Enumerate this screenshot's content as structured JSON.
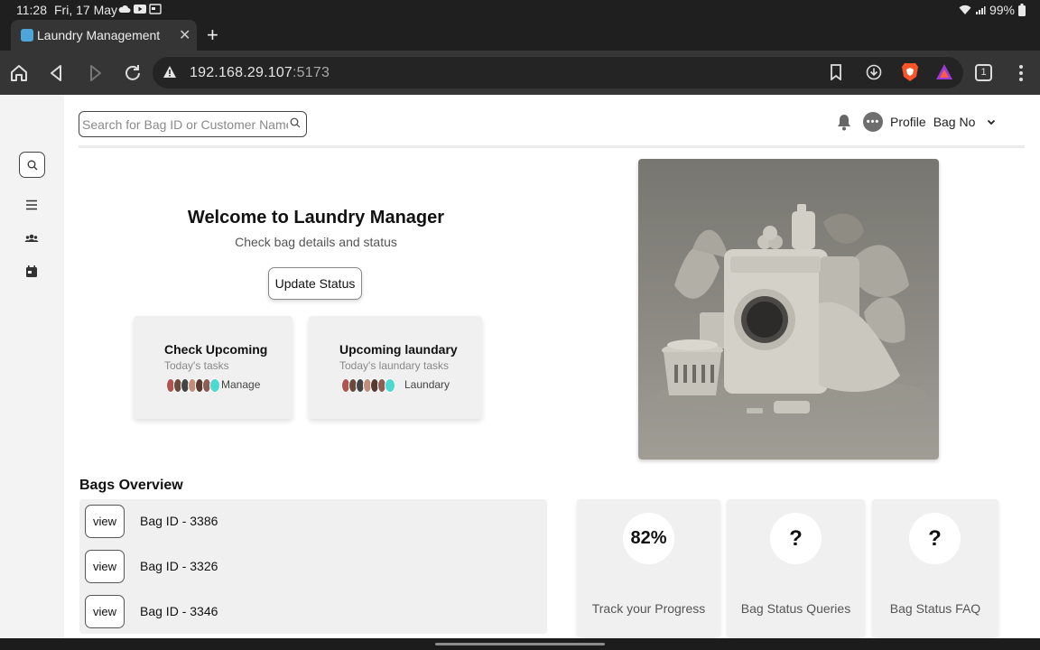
{
  "statusbar": {
    "time": "11:28",
    "date": "Fri, 17 May",
    "battery": "99%"
  },
  "browser": {
    "tab_title": "Laundry Management",
    "url_host": "192.168.29.107",
    "url_port": ":5173",
    "tab_count": "1"
  },
  "header": {
    "search_placeholder": "Search for Bag ID or Customer Name",
    "profile_label": "Profile",
    "bagno_label": "Bag No"
  },
  "welcome": {
    "title": "Welcome to Laundry Manager",
    "subtitle": "Check bag details and status",
    "update_button": "Update Status"
  },
  "cards": [
    {
      "title": "Check Upcoming",
      "subtitle": "Today's tasks",
      "link": "Manage"
    },
    {
      "title": "Upcoming laundary",
      "subtitle": "Today's laundary tasks",
      "link": "Laundary"
    }
  ],
  "overview": {
    "title": "Bags Overview",
    "view_label": "view",
    "bags": [
      "Bag ID - 3386",
      "Bag ID - 3326",
      "Bag ID - 3346"
    ]
  },
  "stats": [
    {
      "value": "82%",
      "label": "Track your Progress"
    },
    {
      "value": "?",
      "label": "Bag Status Queries"
    },
    {
      "value": "?",
      "label": "Bag Status FAQ"
    }
  ],
  "colors": {
    "sidebar_bg": "#f3f3f3",
    "card_bg": "#f0f0f0",
    "avatar_accent": "#4dd9d2",
    "browser_chrome": "#353535"
  }
}
